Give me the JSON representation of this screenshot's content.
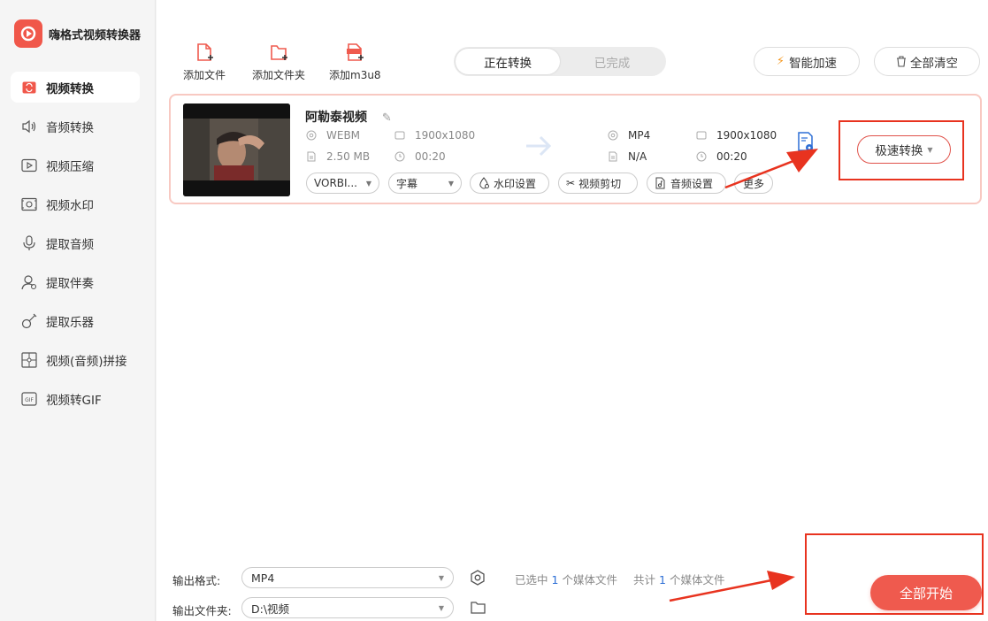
{
  "app": {
    "title": "嗨格式视频转换器"
  },
  "sidebar": {
    "items": [
      {
        "label": "视频转换",
        "icon": "video-convert-icon",
        "active": true
      },
      {
        "label": "音频转换",
        "icon": "speaker-icon"
      },
      {
        "label": "视频压缩",
        "icon": "video-compress-icon"
      },
      {
        "label": "视频水印",
        "icon": "watermark-icon"
      },
      {
        "label": "提取音频",
        "icon": "microphone-icon"
      },
      {
        "label": "提取伴奏",
        "icon": "accompaniment-icon"
      },
      {
        "label": "提取乐器",
        "icon": "guitar-icon"
      },
      {
        "label": "视频(音频)拼接",
        "icon": "splice-icon"
      },
      {
        "label": "视频转GIF",
        "icon": "gif-icon"
      }
    ]
  },
  "toolbar": {
    "add_file": "添加文件",
    "add_folder": "添加文件夹",
    "add_m3u8": "添加m3u8",
    "tab_converting": "正在转换",
    "tab_done": "已完成",
    "smart_accel": "智能加速",
    "clear_all": "全部清空"
  },
  "file": {
    "name": "阿勒泰视频",
    "src_format": "WEBM",
    "src_resolution": "1900x1080",
    "src_size": "2.50 MB",
    "src_duration": "00:20",
    "dst_format": "MP4",
    "dst_resolution": "1900x1080",
    "dst_size": "N/A",
    "dst_duration": "00:20",
    "audio_track": "VORBI...",
    "subtitle": "字幕",
    "watermark": "水印设置",
    "cut": "视频剪切",
    "audio_settings": "音频设置",
    "more": "更多",
    "fast_convert": "极速转换"
  },
  "bottom": {
    "output_format_label": "输出格式:",
    "output_format_value": "MP4",
    "output_folder_label": "输出文件夹:",
    "output_folder_value": "D:\\视频",
    "selected_prefix": "已选中",
    "selected_count": "1",
    "selected_suffix": "个媒体文件",
    "total_prefix": "共计",
    "total_count": "1",
    "total_suffix": "个媒体文件",
    "start_all": "全部开始"
  },
  "colors": {
    "accent": "#ef5a4e",
    "annotation": "#e8331f",
    "link": "#2d6fd6"
  }
}
